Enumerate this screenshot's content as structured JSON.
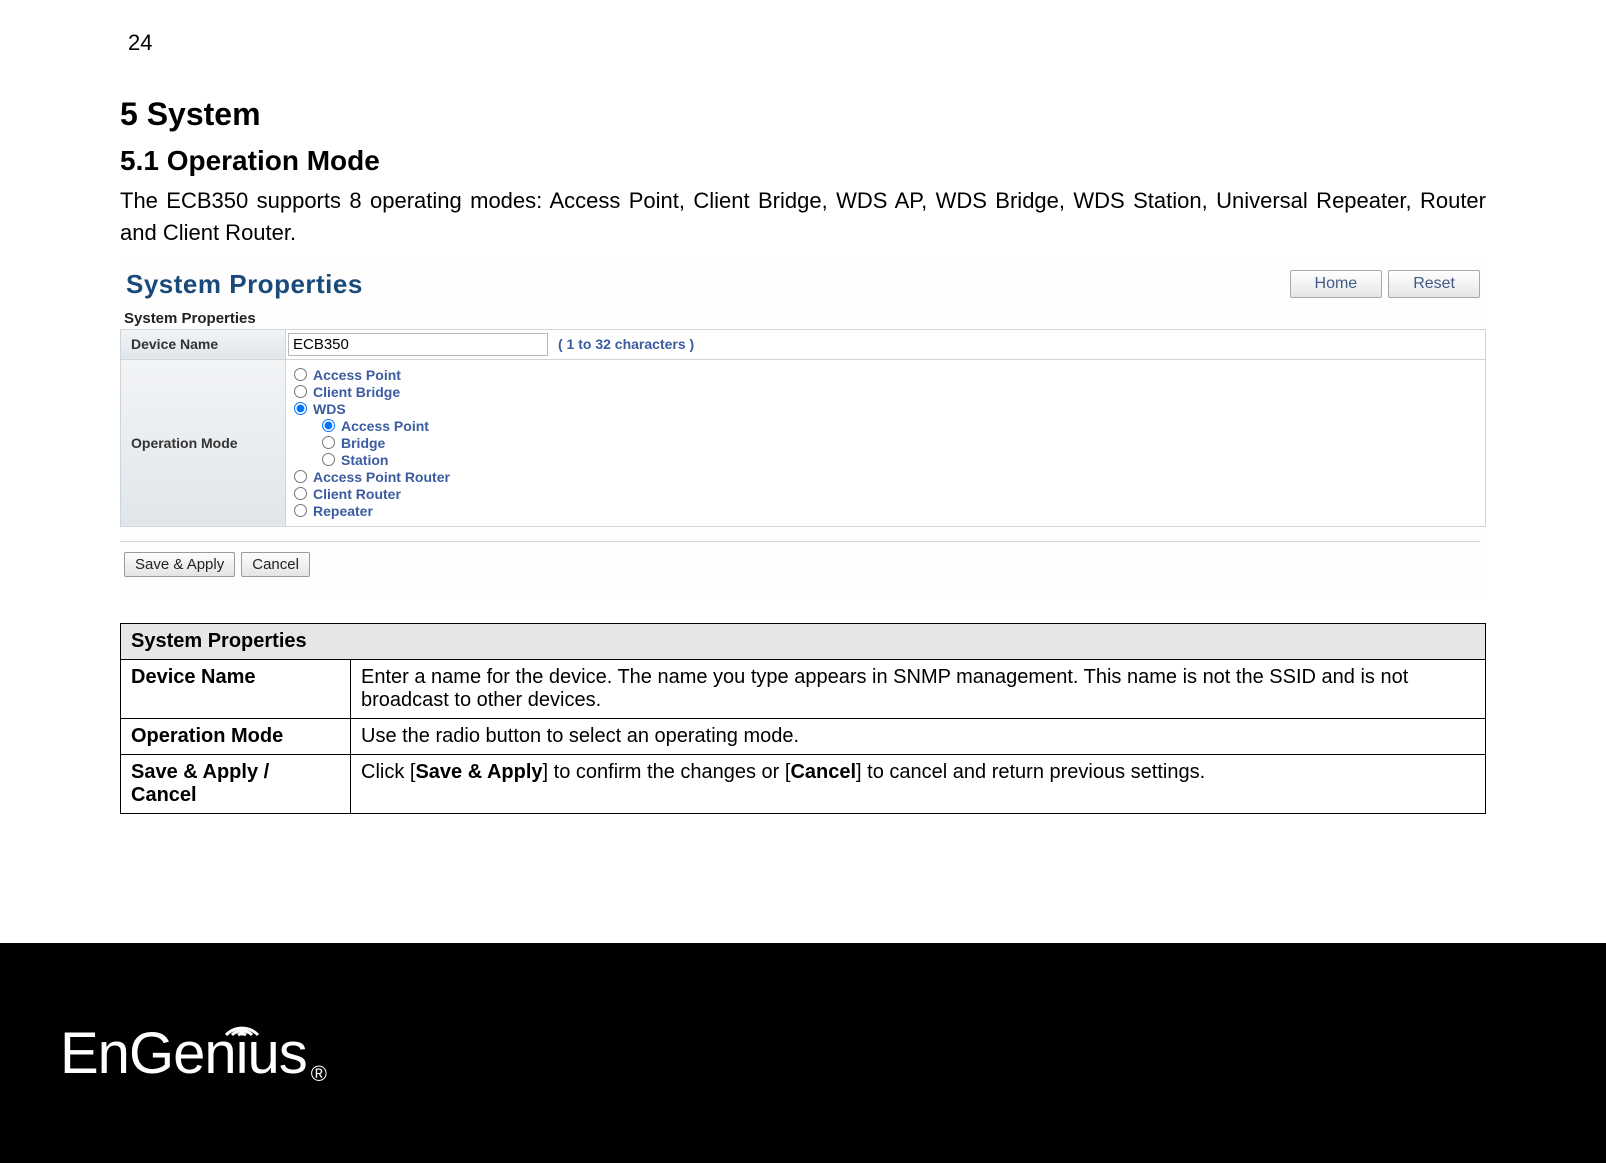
{
  "page_number": "24",
  "h1": "5  System",
  "h2": "5.1   Operation Mode",
  "intro": "The ECB350 supports 8 operating modes: Access Point, Client Bridge, WDS AP, WDS Bridge, WDS Station, Universal Repeater, Router and Client Router.",
  "ui": {
    "title": "System Properties",
    "home_btn": "Home",
    "reset_btn": "Reset",
    "section_label": "System Properties",
    "device_name_label": "Device Name",
    "device_name_value": "ECB350",
    "device_name_hint": "( 1 to 32 characters )",
    "op_mode_label": "Operation Mode",
    "modes": {
      "m0": "Access Point",
      "m1": "Client Bridge",
      "m2": "WDS",
      "m2a": "Access Point",
      "m2b": "Bridge",
      "m2c": "Station",
      "m3": "Access Point Router",
      "m4": "Client Router",
      "m5": "Repeater"
    },
    "save_btn": "Save & Apply",
    "cancel_btn": "Cancel"
  },
  "desc": {
    "header": "System Properties",
    "r1_label": "Device Name",
    "r1_text": "Enter a name for the device. The name you type appears in SNMP management. This name is not the SSID and is not broadcast to other devices.",
    "r2_label": "Operation Mode",
    "r2_text": "Use the radio button to select an operating mode.",
    "r3_label": "Save & Apply / Cancel",
    "r3_pre": "Click [",
    "r3_b1": "Save & Apply",
    "r3_mid": "] to confirm the changes or [",
    "r3_b2": "Cancel",
    "r3_post": "] to cancel and return previous settings."
  },
  "logo_text": "EnGenius"
}
